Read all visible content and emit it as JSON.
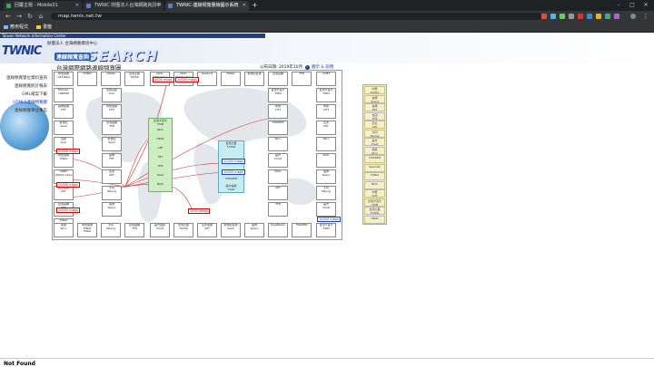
{
  "browser": {
    "tabs": [
      {
        "label": "回覆主題 - Mobile01",
        "favicon_color": "#3fa84a",
        "active": false
      },
      {
        "label": "TWNIC 財團法人台灣網路資訊中",
        "favicon_color": "#5a7fc4",
        "active": false
      },
      {
        "label": "TWNIC-連線頻寬量線圖示系統",
        "favicon_color": "#5a7fc4",
        "active": true
      }
    ],
    "new_tab": "+",
    "url": "map.twnic.net.tw",
    "bookmarks": [
      {
        "label": "應用程式",
        "icon_color": "#8ab4f8"
      },
      {
        "label": "書籤",
        "icon_color": "#f2c84b"
      }
    ],
    "window_buttons": [
      "–",
      "□",
      "✕"
    ]
  },
  "header": {
    "strip": "Taiwan Network Information Center",
    "logo": "TWNIC",
    "org": "財團法人 台灣網路資訊中心",
    "search_word": "SEARCH",
    "search_cn": "連線頻寬查詢"
  },
  "sidenav": [
    {
      "label": "連線頻寬量位資料查詢",
      "current": false
    },
    {
      "label": "連線頻寬統計報表",
      "current": false
    },
    {
      "label": "GML檔案下載",
      "current": false
    },
    {
      "label": "HTML5連線頻寬圖",
      "current": true
    },
    {
      "label": "連線頻寬單位專區",
      "current": false
    }
  ],
  "page": {
    "title": "台灣網際網路連線頻寬圖",
    "date": "公布日期: 2019年10月",
    "help": "i",
    "note": "圖示 & 說明"
  },
  "map": {
    "top_row": [
      "中華電信\nUS/HINet",
      "TWNIC",
      "ASNet",
      "台灣之星\nTSTAR",
      "NCIC\n4000 mbps",
      "NCIC\n20000 mbps",
      "Seednet",
      "TANet",
      "新世紀資通",
      "台灣固網",
      "TFN",
      "CHIEF"
    ],
    "left_col": [
      "Ministry\nLINKMN",
      "遠傳電信\nFET",
      "新世紀\nSeed",
      "宏碁\nAcer",
      "中華電信\nHiNet",
      "HINET\n20000 mbps",
      "亞太電信\nAPT",
      "台灣固網\nTFN",
      "TANet\n10000 mbps",
      "遠傳電信\nFET"
    ],
    "right_col": [
      "台灣大哥大\nTWM",
      "中華\nCHT",
      "亞太\nAPT",
      "Kbro",
      "NCIC",
      "速博\nSparq",
      "大同\nTatung",
      "是方\nChief",
      "TWAREN",
      "凱擘\nKbro",
      "台固\nTFN",
      "遠傳\nFET"
    ],
    "bottom_row": [
      "凱擘\nKbro",
      "中華電信HiNet\nHiNet",
      "大同\nTatung",
      "台灣固網\nTFN",
      "是方電訊\nChief",
      "台灣之星\nTSTAR",
      "亞太電信\nAPT",
      "新世紀資通\nSeed",
      "速博\nSparq",
      "GigaMedia",
      "TWAREN",
      "台灣大哥大\nTWM"
    ],
    "inner_left": [
      "宏碁資訊\nAcer",
      "中華電信\nCHT",
      "台灣固網\nTFN",
      "新世紀\nSeed",
      "遠傳\nFET",
      "亞太\nAPT",
      "大同\nTatung",
      "速博\nSparq",
      "台灣之星\nTSTAR",
      "凱擘\nKbro"
    ],
    "inner_mid_right": [
      "台灣大哥大\nTWM",
      "中華\nCHT",
      "TWAREN",
      "Kbro",
      "是方\nChief",
      "NCIC",
      "APT",
      "TFN",
      "FET",
      "Seed"
    ],
    "far_right": [
      "台灣大哥大\nTWM",
      "中華電信\nCHT",
      "遠傳\nFET",
      "亞太\nAPT",
      "新世紀\nSeed",
      "台固\nTFN",
      "是方\nChief",
      "大同\nTatung",
      "速博\nSparq",
      "TWAREN"
    ],
    "green_items": [
      "台灣大哥大\nTWM",
      "Kbro",
      "HiNet",
      "APT",
      "FET",
      "TFN",
      "Seed",
      "NCIC"
    ],
    "cyan_items": [
      "台灣之星\nTSTAR",
      "12000 mbps",
      "10000 mbps",
      "TWAREN",
      "是方電訊\nChief"
    ],
    "red_labels": [
      "20000 mbps",
      "20000 mbps",
      "10000 mbps",
      "4000 mbps",
      "20000 mbps",
      "1000 mbps"
    ],
    "blue_labels": [
      "12000 mbps",
      "10000 mbps",
      "1000 mbps",
      "10000 mbps"
    ],
    "legend": [
      "中華\nChtfax",
      "速博\nSparq",
      "遠傳\nFET",
      "台固\nTFN",
      "亞太\nAPT",
      "大同\nTatung",
      "是方\nChief",
      "凱擘\nKbro",
      "TWAREN",
      "Seednet",
      "TANet",
      "NCIC",
      "中華\nCHT",
      "台灣大哥大\nTWM",
      "台灣之星\nTSTAR",
      "HiNet"
    ]
  },
  "footer": {
    "not_found": "Not Found"
  }
}
